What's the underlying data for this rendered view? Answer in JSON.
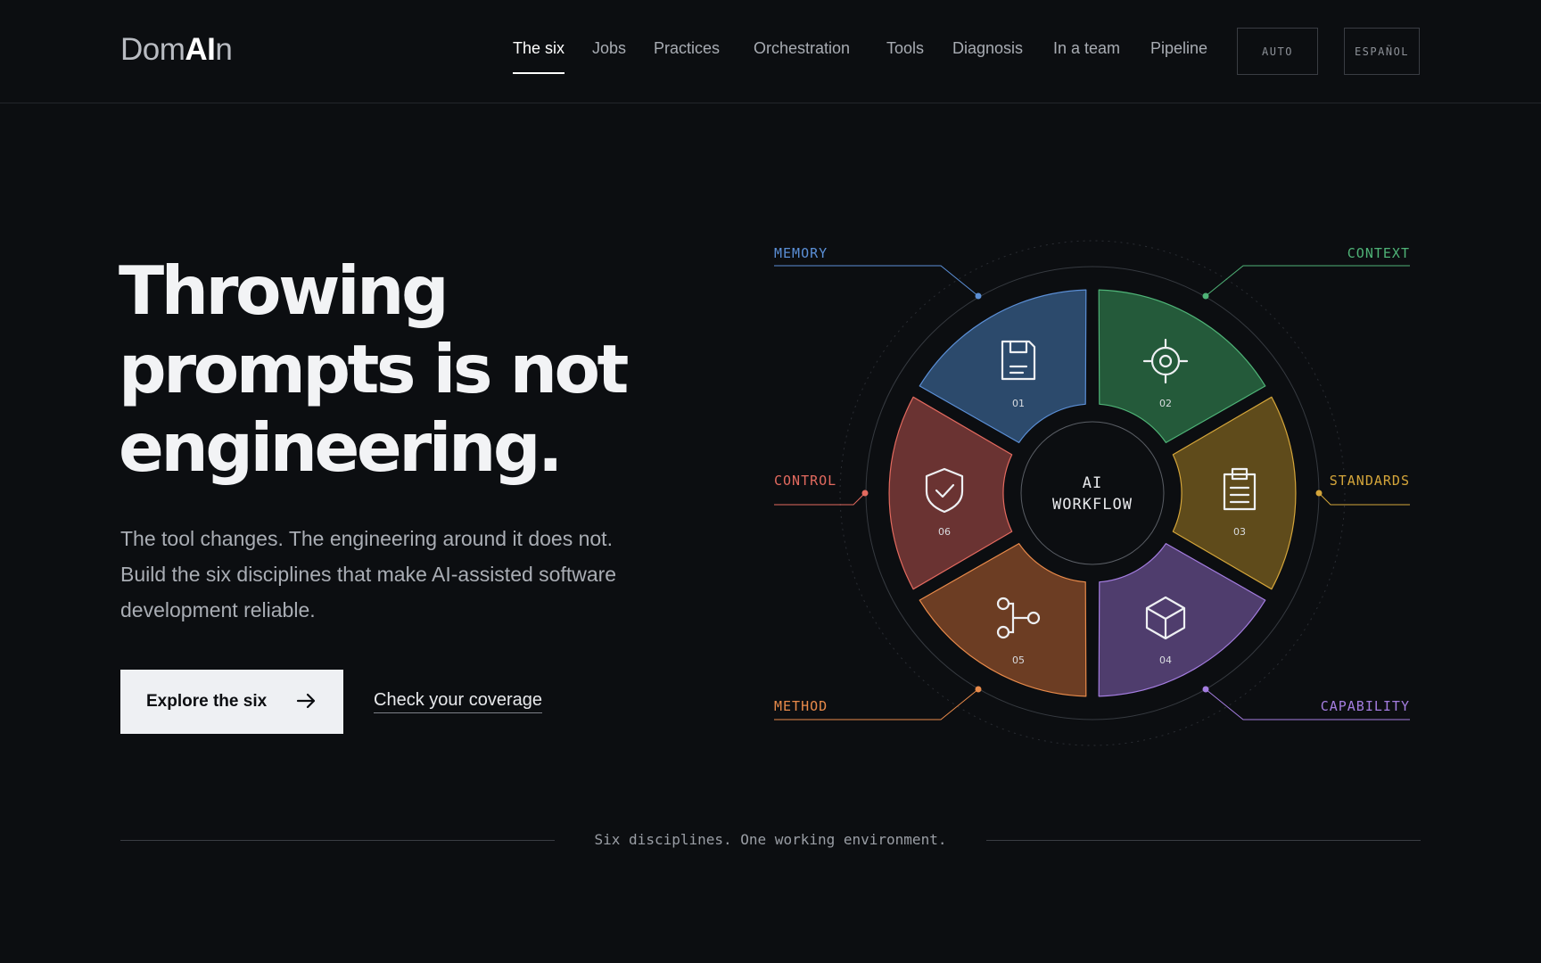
{
  "header": {
    "logo": {
      "part1": "Dom",
      "part2": "AI",
      "part3": "n"
    },
    "nav": [
      {
        "label": "The six",
        "active": true
      },
      {
        "label": "Jobs"
      },
      {
        "label": "Practices"
      },
      {
        "label": "Orchestration"
      },
      {
        "label": "Tools"
      },
      {
        "label": "Diagnosis"
      },
      {
        "label": "In a team"
      },
      {
        "label": "Pipeline"
      }
    ],
    "theme_button": "AUTO",
    "language_button": "ESPAÑOL"
  },
  "hero": {
    "title_lines": [
      "Throwing",
      "prompts is not",
      "engineering."
    ],
    "subtitle": "The tool changes. The engineering around it does not. Build the six disciplines that make AI-assisted software development reliable.",
    "primary_cta": "Explore the six",
    "secondary_cta": "Check your coverage"
  },
  "wheel": {
    "center_line1": "AI",
    "center_line2": "WORKFLOW",
    "segments": [
      {
        "num": "01",
        "label": "MEMORY",
        "icon": "save-document-icon",
        "color": "#5b8fd6",
        "fill": "#2c4a6c"
      },
      {
        "num": "02",
        "label": "CONTEXT",
        "icon": "target-icon",
        "color": "#4fb377",
        "fill": "#245a3a"
      },
      {
        "num": "03",
        "label": "STANDARDS",
        "icon": "clipboard-icon",
        "color": "#d4a53a",
        "fill": "#5f4b1b"
      },
      {
        "num": "04",
        "label": "CAPABILITY",
        "icon": "cube-icon",
        "color": "#a47de0",
        "fill": "#4f3d6d"
      },
      {
        "num": "05",
        "label": "METHOD",
        "icon": "branch-icon",
        "color": "#e88a4a",
        "fill": "#6c3d23"
      },
      {
        "num": "06",
        "label": "CONTROL",
        "icon": "shield-check-icon",
        "color": "#e36a5f",
        "fill": "#6a3332"
      }
    ]
  },
  "footer": {
    "tagline": "Six disciplines. One working environment."
  }
}
